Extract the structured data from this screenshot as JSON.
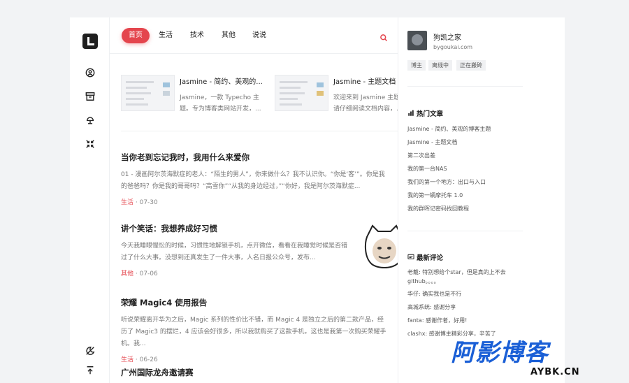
{
  "nav": {
    "items": [
      "首页",
      "生活",
      "技术",
      "其他",
      "说说"
    ],
    "active_index": 0
  },
  "featured": [
    {
      "title": "Jasmine - 简约、美观的...",
      "desc": "Jasmine，一款 Typecho 主题。专为博客类网站开发，..."
    },
    {
      "title": "Jasmine - 主题文档",
      "desc": "欢迎来到 Jasmine 主题文档，请仔细阅读文档内容，..."
    }
  ],
  "posts": [
    {
      "title": "当你老到忘记我时，我用什么来爱你",
      "summary": "01 - 漫画阿尔茨海默症的老人：“陌生的男人”，你来做什么？我不认识你。“你是‘客’”。你是我的爸爸吗？你是我的哥哥吗？“高雪你”“从我的身边经过，”“你好，我是阿尔茨海默症...",
      "category": "生活",
      "date": "07-30"
    },
    {
      "title": "讲个笑话：我想养成好习惯",
      "summary": "今天我睡眼惺忪的时候，习惯性地解锁手机，点开微信，看看在我睡觉时候是否错过了什么大事。没想到还真发生了一件大事，人名日报公众号，发布...",
      "category": "其他",
      "date": "07-06"
    },
    {
      "title": "荣耀 Magic4 使用报告",
      "summary": "听说荣耀离开华为之后，Magic 系列的性价比不错，而 Magic 4 是独立之后的第二款产品，经历了 Magic3 的摆烂，4 应该会好很多，所以我就购买了这款手机，这也是我第一次购买荣耀手机。我...",
      "category": "生活",
      "date": "06-26"
    },
    {
      "title": "广州国际龙舟邀请赛",
      "summary": "",
      "category": "",
      "date": ""
    }
  ],
  "sidebar": {
    "blog_name": "狗凯之家",
    "blog_url": "bygoukai.com",
    "tags": [
      "博主",
      "离线中",
      "正在搬砖"
    ],
    "hot_title": "热门文章",
    "hot_articles": [
      "Jasmine - 简约、美观的博客主题",
      "Jasmine - 主题文档",
      "第二次出差",
      "我的第一台NAS",
      "我们的第一个地方：出口与入口",
      "我的第一辆摩托车 1.0",
      "我的群晖记密码找回教程"
    ],
    "comment_title": "最新评论",
    "comments": [
      "老戴: 特别想给个star，但是真的上不去github。。。。",
      "华仔: 确实我也是不行",
      "高城系统: 感谢分享",
      "fanta: 感谢作者，好用!",
      "clashx: 感谢博主精彩分享，辛苦了"
    ]
  },
  "watermark": {
    "text": "阿影博客",
    "sub": "AYBK.CN"
  },
  "colors": {
    "accent": "#e4454d",
    "watermark": "#1a5fd6"
  }
}
